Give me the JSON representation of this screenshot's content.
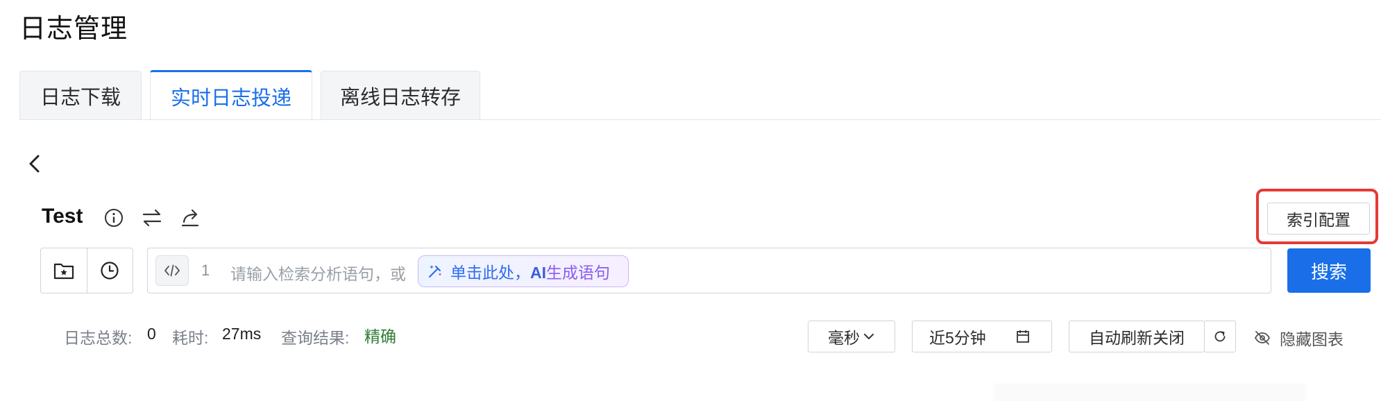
{
  "page": {
    "title": "日志管理"
  },
  "tabs": [
    {
      "label": "日志下载",
      "active": false
    },
    {
      "label": "实时日志投递",
      "active": true
    },
    {
      "label": "离线日志转存",
      "active": false
    }
  ],
  "log": {
    "name": "Test"
  },
  "toolbar": {
    "index_config_label": "索引配置"
  },
  "query": {
    "line_number": "1",
    "placeholder": "请输入检索分析语句，或",
    "ai_prefix": "单击此处，",
    "ai_bold": "AI",
    "ai_suffix": "生成语句"
  },
  "search": {
    "label": "搜索"
  },
  "stats": {
    "total_label": "日志总数:",
    "total_value": "0",
    "time_label": "耗时:",
    "time_value": "27ms",
    "result_label": "查询结果:",
    "result_value": "精确"
  },
  "controls": {
    "unit": "毫秒",
    "time_range": "近5分钟",
    "auto_refresh": "自动刷新关闭",
    "hide_chart": "隐藏图表"
  },
  "colors": {
    "accent": "#1a6fe8",
    "highlight": "#e53935",
    "success": "#2e7d32"
  }
}
